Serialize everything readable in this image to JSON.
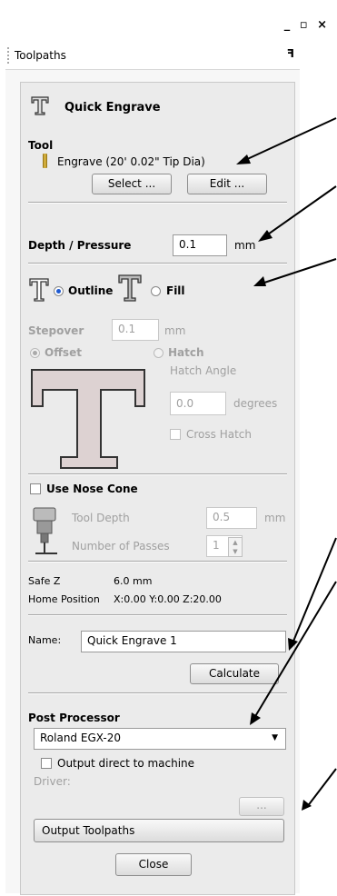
{
  "window": {
    "controls": "_ & ×"
  },
  "toolpaths": {
    "title": "Toolpaths",
    "pin": "Ψ"
  },
  "quick_engrave": {
    "title": "Quick Engrave"
  },
  "tool": {
    "heading": "Tool",
    "name": "Engrave (20' 0.02\" Tip Dia)",
    "select_label": "Select ...",
    "edit_label": "Edit ..."
  },
  "depth": {
    "label": "Depth / Pressure",
    "value": "0.1",
    "unit": "mm"
  },
  "mode": {
    "outline_label": "Outline",
    "fill_label": "Fill",
    "selected": "Outline"
  },
  "stepover": {
    "label": "Stepover",
    "value": "0.1",
    "unit": "mm"
  },
  "strategy": {
    "offset_label": "Offset",
    "hatch_label": "Hatch",
    "hatch_angle_label": "Hatch Angle",
    "hatch_angle_value": "0.0",
    "hatch_angle_unit": "degrees",
    "cross_hatch_label": "Cross Hatch"
  },
  "nose_cone": {
    "label": "Use Nose Cone",
    "tool_depth_label": "Tool Depth",
    "tool_depth_value": "0.5",
    "tool_depth_unit": "mm",
    "passes_label": "Number of Passes",
    "passes_value": "1"
  },
  "info": {
    "safe_z_label": "Safe Z",
    "safe_z_value": "6.0 mm",
    "home_label": "Home Position",
    "home_value": "X:0.00 Y:0.00 Z:20.00"
  },
  "name_row": {
    "label": "Name:",
    "value": "Quick Engrave 1"
  },
  "calculate_label": "Calculate",
  "post_processor": {
    "heading": "Post Processor",
    "selected": "Roland EGX-20",
    "output_direct_label": "Output direct to machine",
    "driver_label": "Driver:",
    "browse_label": "...",
    "output_toolpaths_label": "Output Toolpaths"
  },
  "close_label": "Close"
}
